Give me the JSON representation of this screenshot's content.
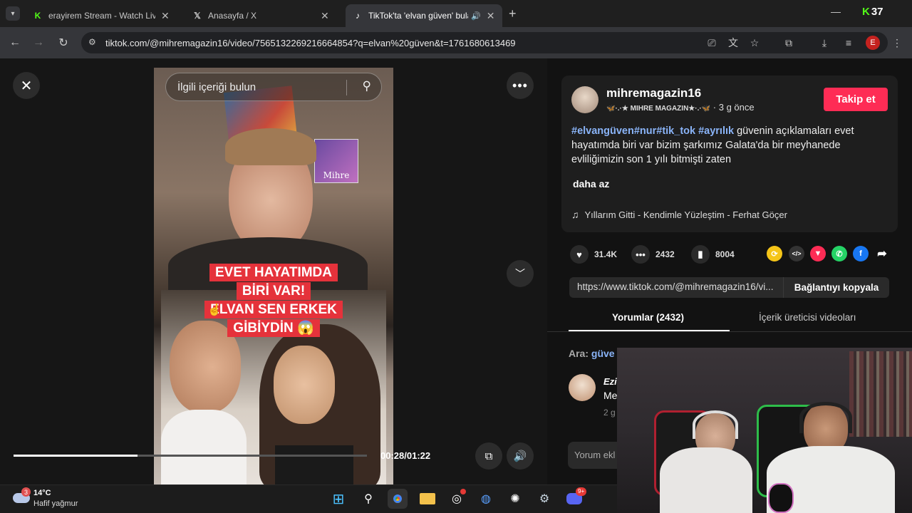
{
  "browser": {
    "tabs": [
      {
        "title": "erayirem Stream - Watch Live o",
        "favicon": "kick-icon",
        "active": false
      },
      {
        "title": "Anasayfa / X",
        "favicon": "x-icon",
        "active": false
      },
      {
        "title": "TikTok'ta 'elvan güven' bula",
        "favicon": "tiktok-icon",
        "active": true
      }
    ],
    "url": "tiktok.com/@mihremagazin16/video/7565132269216664854?q=elvan%20güven&t=1761680613469",
    "profile_initial": "E",
    "corner_badge": "37"
  },
  "video": {
    "search_placeholder": "İlgili içeriği bulun",
    "caption_lines": [
      "EVET HAYATIMDA",
      "BİRİ VAR!",
      "ELVAN SEN ERKEK",
      "GİBİYDİN 😱"
    ],
    "logo_text": "Mihre",
    "time": "00:28/01:22",
    "progress": 0.35
  },
  "post": {
    "username": "mihremagazin16",
    "display_name": "🦋·.·★ MIHRE MAGAZIN★·.·🦋",
    "posted": "3 g önce",
    "follow_label": "Takip et",
    "hashtags": "#elvangüven#nur#tik_tok #ayrılık",
    "description": " güvenin açıklamaları evet hayatımda biri var bizim şarkımız Galata'da bir meyhanede evliliğimizin son 1 yılı bitmişti zaten",
    "less_label": "daha az",
    "music": "Yıllarım Gitti - Kendimle Yüzleştim - Ferhat Göçer",
    "likes": "31.4K",
    "comments": "2432",
    "saves": "8004",
    "link": "https://www.tiktok.com/@mihremagazin16/vi...",
    "copy_label": "Bağlantıyı kopyala",
    "tab_comments": "Yorumlar (2432)",
    "tab_creator": "İçerik üreticisi videoları",
    "search_prefix": "Ara:",
    "search_term": "güve",
    "comment_name": "Ezi",
    "comment_text": "Me",
    "comment_time": "2 g",
    "comment_placeholder": "Yorum ekl"
  },
  "taskbar": {
    "temp": "14°C",
    "weather": "Hafif yağmur",
    "weather_badge": "3",
    "discord_badge": "9+"
  },
  "colors": {
    "follow": "#fe2c55",
    "caption_bg": "#e5323b",
    "hashtag": "#8ab4f8"
  }
}
